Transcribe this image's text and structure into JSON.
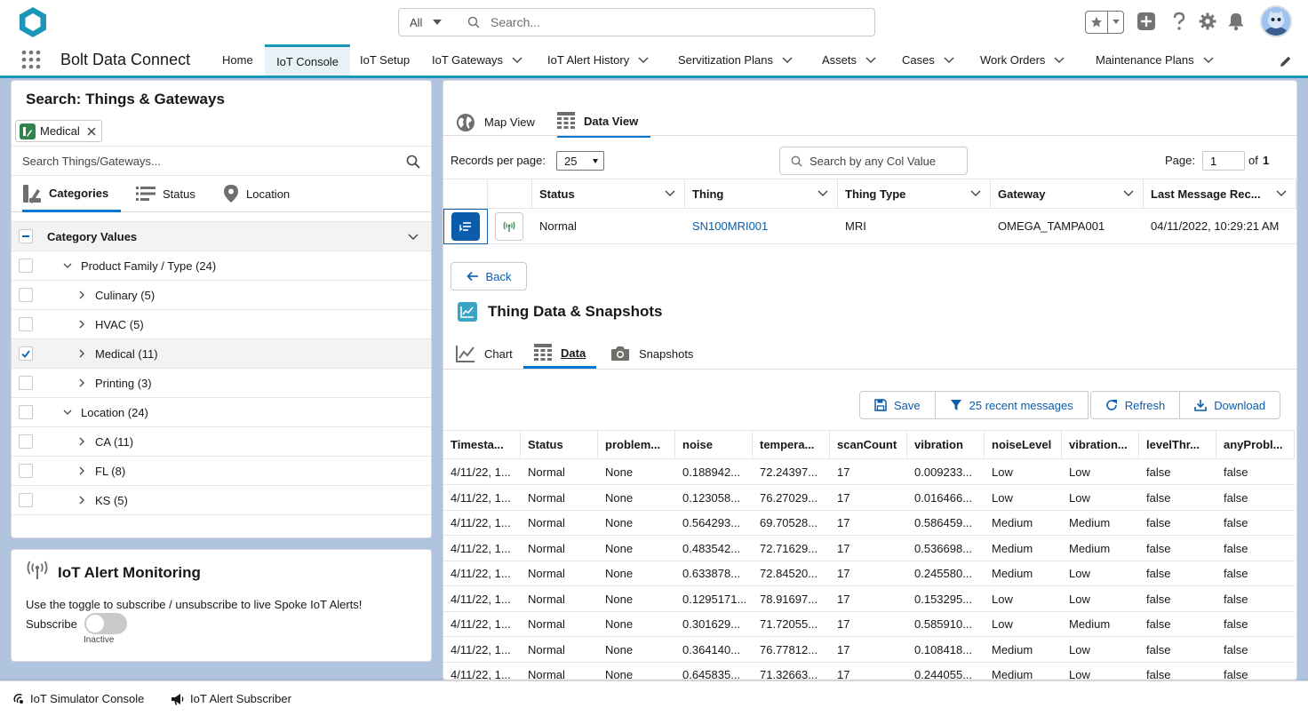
{
  "header": {
    "search_scope": "All",
    "search_placeholder": "Search...",
    "app_name": "Bolt Data Connect"
  },
  "nav": [
    {
      "label": "Home",
      "dropdown": false
    },
    {
      "label": "IoT Console",
      "dropdown": false,
      "active": true
    },
    {
      "label": "IoT Setup",
      "dropdown": false
    },
    {
      "label": "IoT Gateways",
      "dropdown": true
    },
    {
      "label": "IoT Alert History",
      "dropdown": true
    },
    {
      "label": "Servitization Plans",
      "dropdown": true
    },
    {
      "label": "Assets",
      "dropdown": true
    },
    {
      "label": "Cases",
      "dropdown": true
    },
    {
      "label": "Work Orders",
      "dropdown": true
    },
    {
      "label": "Maintenance Plans",
      "dropdown": true
    }
  ],
  "left": {
    "title": "Search: Things & Gateways",
    "pill_label": "Medical",
    "search_placeholder": "Search Things/Gateways...",
    "tabs": [
      "Categories",
      "Status",
      "Location"
    ],
    "tree_header": "Category Values",
    "tree": [
      {
        "label": "Product Family / Type (24)",
        "level": 1,
        "expanded": true,
        "checked": false
      },
      {
        "label": "Culinary (5)",
        "level": 2,
        "expanded": false,
        "checked": false
      },
      {
        "label": "HVAC (5)",
        "level": 2,
        "expanded": false,
        "checked": false
      },
      {
        "label": "Medical (11)",
        "level": 2,
        "expanded": false,
        "checked": true
      },
      {
        "label": "Printing (3)",
        "level": 2,
        "expanded": false,
        "checked": false
      },
      {
        "label": "Location (24)",
        "level": 1,
        "expanded": true,
        "checked": false
      },
      {
        "label": "CA (11)",
        "level": 2,
        "expanded": false,
        "checked": false
      },
      {
        "label": "FL (8)",
        "level": 2,
        "expanded": false,
        "checked": false
      },
      {
        "label": "KS (5)",
        "level": 2,
        "expanded": false,
        "checked": false
      }
    ]
  },
  "alert": {
    "title": "IoT Alert Monitoring",
    "description": "Use the toggle to subscribe / unsubscribe to live Spoke IoT Alerts!",
    "subscribe_label": "Subscribe",
    "toggle_state": "Inactive"
  },
  "view_tabs": [
    "Map View",
    "Data View"
  ],
  "records": {
    "label": "Records per page:",
    "value": "25",
    "col_search_placeholder": "Search by any Col Value",
    "page_label": "Page:",
    "page_value": "1",
    "page_of": "of",
    "page_total": "1"
  },
  "thing_table": {
    "headers": [
      "Status",
      "Thing",
      "Thing Type",
      "Gateway",
      "Last Message Rec..."
    ],
    "row": {
      "status": "Normal",
      "thing": "SN100MRI001",
      "thing_type": "MRI",
      "gateway": "OMEGA_TAMPA001",
      "last_message": "04/11/2022, 10:29:21 AM"
    }
  },
  "back_label": "Back",
  "snapshots": {
    "title": "Thing Data & Snapshots",
    "tabs": [
      "Chart",
      "Data",
      "Snapshots"
    ],
    "buttons": {
      "save": "Save",
      "recent": "25 recent messages",
      "refresh": "Refresh",
      "download": "Download"
    }
  },
  "data_table": {
    "headers": [
      "Timesta...",
      "Status",
      "problem...",
      "noise",
      "tempera...",
      "scanCount",
      "vibration",
      "noiseLevel",
      "vibration...",
      "levelThr...",
      "anyProbl..."
    ],
    "rows": [
      [
        "4/11/22, 1...",
        "Normal",
        "None",
        "0.188942...",
        "72.24397...",
        "17",
        "0.009233...",
        "Low",
        "Low",
        "false",
        "false"
      ],
      [
        "4/11/22, 1...",
        "Normal",
        "None",
        "0.123058...",
        "76.27029...",
        "17",
        "0.016466...",
        "Low",
        "Low",
        "false",
        "false"
      ],
      [
        "4/11/22, 1...",
        "Normal",
        "None",
        "0.564293...",
        "69.70528...",
        "17",
        "0.586459...",
        "Medium",
        "Medium",
        "false",
        "false"
      ],
      [
        "4/11/22, 1...",
        "Normal",
        "None",
        "0.483542...",
        "72.71629...",
        "17",
        "0.536698...",
        "Medium",
        "Medium",
        "false",
        "false"
      ],
      [
        "4/11/22, 1...",
        "Normal",
        "None",
        "0.633878...",
        "72.84520...",
        "17",
        "0.245580...",
        "Medium",
        "Low",
        "false",
        "false"
      ],
      [
        "4/11/22, 1...",
        "Normal",
        "None",
        "0.1295171...",
        "78.91697...",
        "17",
        "0.153295...",
        "Low",
        "Low",
        "false",
        "false"
      ],
      [
        "4/11/22, 1...",
        "Normal",
        "None",
        "0.301629...",
        "71.72055...",
        "17",
        "0.585910...",
        "Low",
        "Medium",
        "false",
        "false"
      ],
      [
        "4/11/22, 1...",
        "Normal",
        "None",
        "0.364140...",
        "76.77812...",
        "17",
        "0.108418...",
        "Medium",
        "Low",
        "false",
        "false"
      ],
      [
        "4/11/22, 1...",
        "Normal",
        "None",
        "0.645835...",
        "71.32663...",
        "17",
        "0.244055...",
        "Medium",
        "Low",
        "false",
        "false"
      ]
    ]
  },
  "utility": [
    "IoT Simulator Console",
    "IoT Alert Subscriber"
  ],
  "colors": {
    "brand": "#1b96b8",
    "link": "#0b5cab",
    "active_tab": "#0176d3",
    "pill": "#2e844a",
    "background": "#b0c4df"
  }
}
